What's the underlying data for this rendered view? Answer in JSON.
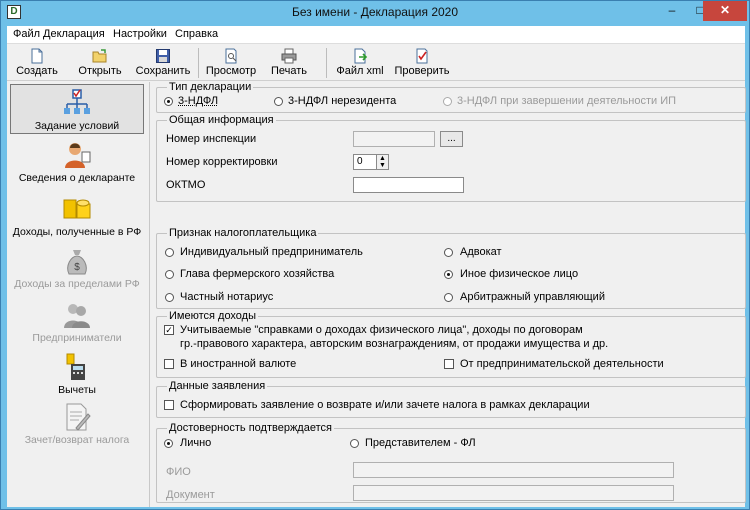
{
  "window": {
    "title": "Без имени - Декларация 2020",
    "min": "–",
    "max": "□",
    "close": "✕"
  },
  "menu": [
    "Файл",
    "Декларация",
    "Настройки",
    "Справка"
  ],
  "toolbar": {
    "create": "Создать",
    "open": "Открыть",
    "save": "Сохранить",
    "preview": "Просмотр",
    "print": "Печать",
    "xml": "Файл xml",
    "check": "Проверить"
  },
  "sidebar": [
    {
      "label": "Задание условий",
      "selected": true
    },
    {
      "label": "Сведения о декларанте"
    },
    {
      "label": "Доходы, полученные в РФ"
    },
    {
      "label": "Доходы за пределами РФ",
      "disabled": true
    },
    {
      "label": "Предприниматели",
      "disabled": true
    },
    {
      "label": "Вычеты"
    },
    {
      "label": "Зачет/возврат налога",
      "disabled": true
    }
  ],
  "decl_type": {
    "title": "Тип декларации",
    "options": [
      "3-НДФЛ",
      "3-НДФЛ нерезидента",
      "3-НДФЛ при завершении деятельности ИП"
    ],
    "selected": "3-НДФЛ"
  },
  "general": {
    "title": "Общая информация",
    "inspection_label": "Номер инспекции",
    "inspection_value": "",
    "browse": "...",
    "correction_label": "Номер корректировки",
    "correction_value": "0",
    "oktmo_label": "ОКТМО",
    "oktmo_value": ""
  },
  "taxpayer": {
    "title": "Признак налогоплательщика",
    "options": [
      "Индивидуальный предприниматель",
      "Адвокат",
      "Глава фермерского хозяйства",
      "Иное физическое лицо",
      "Частный нотариус",
      "Арбитражный управляющий"
    ],
    "selected": "Иное физическое лицо"
  },
  "income": {
    "title": "Имеются доходы",
    "main_line1": "Учитываемые \"справками о доходах физического лица\", доходы по договорам",
    "main_line2": "гр.-правового характера, авторским вознаграждениям, от продажи имущества и др.",
    "main_checked": true,
    "foreign": "В иностранной валюте",
    "foreign_checked": false,
    "business": "От предпринимательской деятельности",
    "business_checked": false
  },
  "statement": {
    "title": "Данные заявления",
    "label": "Сформировать заявление о  возврате и/или зачете налога в рамках декларации",
    "checked": false
  },
  "reliability": {
    "title": "Достоверность подтверждается",
    "options": [
      "Лично",
      "Представителем - ФЛ"
    ],
    "selected": "Лично",
    "fio_label": "ФИО",
    "fio_value": "",
    "doc_label": "Документ",
    "doc_value": ""
  }
}
